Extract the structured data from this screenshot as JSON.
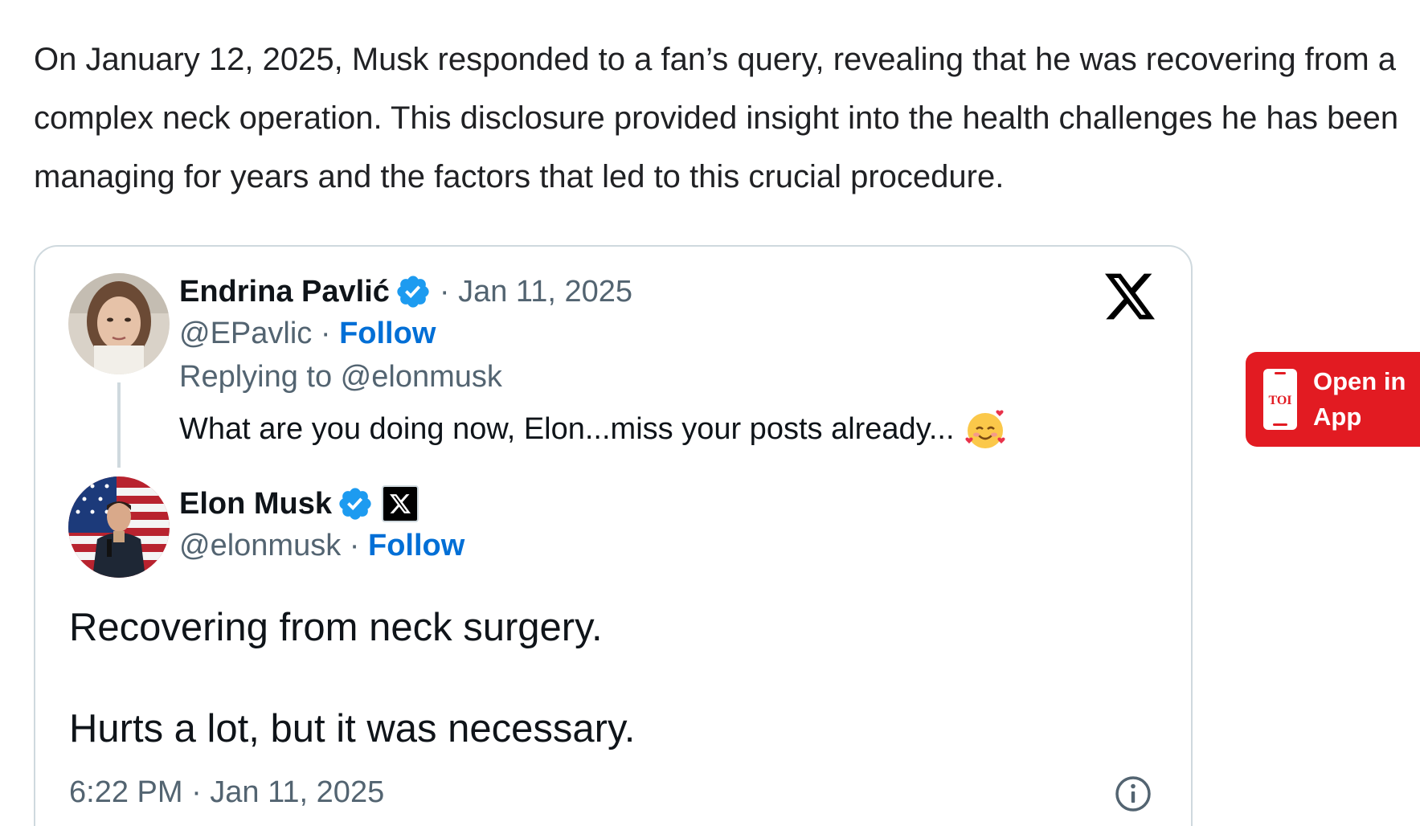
{
  "article": {
    "paragraph": "On January 12, 2025, Musk responded to a fan’s query, revealing that he was recovering from a complex neck operation. This disclosure provided insight into the health challenges he has been managing for years and the factors that led to this crucial procedure."
  },
  "embed": {
    "brand_icon": "x-logo-icon",
    "reply_tweet": {
      "author_name": "Endrina Pavlić",
      "verified_icon": "verified-badge-icon",
      "date": "· Jan 11, 2025",
      "handle": "@EPavlic ·",
      "follow_label": "Follow",
      "replying_to": "Replying to @elonmusk",
      "text": "What are you doing now, Elon...miss your posts already...",
      "emoji_icon": "smiling-face-with-hearts-icon"
    },
    "main_tweet": {
      "author_name": "Elon Musk",
      "verified_icon": "verified-badge-icon",
      "affiliation_icon": "x-affiliate-badge-icon",
      "handle": "@elonmusk ·",
      "follow_label": "Follow",
      "text_line1": "Recovering from neck surgery.",
      "text_line2": "Hurts a lot, but it was necessary.",
      "timestamp": "6:22 PM · Jan 11, 2025",
      "info_icon": "info-circle-icon"
    }
  },
  "open_in_app": {
    "logo_text": "TOI",
    "label": "Open in\nApp",
    "color": "#e21b22"
  },
  "colors": {
    "follow_link": "#006fd6",
    "verified": "#1d9bf0",
    "secondary_text": "#536471",
    "border": "#cfd9de"
  }
}
